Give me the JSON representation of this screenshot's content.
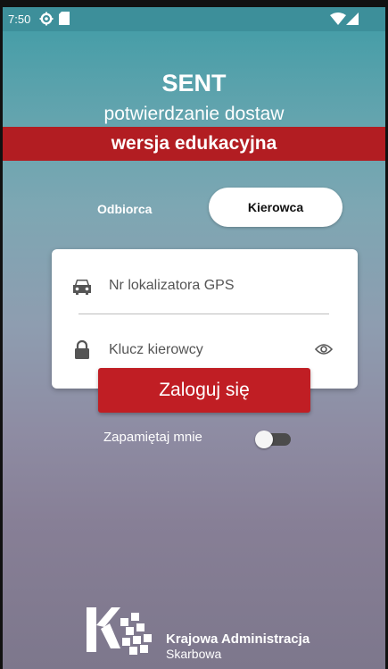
{
  "status_bar": {
    "time": "7:50",
    "icons": [
      "settings-icon",
      "sd-card-icon",
      "wifi-icon",
      "signal-icon"
    ]
  },
  "header": {
    "app_name": "SENT",
    "subtitle": "potwierdzanie dostaw",
    "edition_banner": "wersja edukacyjna"
  },
  "role_toggle": {
    "option_receiver": "Odbiorca",
    "option_driver": "Kierowca",
    "selected": "Kierowca"
  },
  "login_form": {
    "gps_field_placeholder": "Nr lokalizatora GPS",
    "driver_key_placeholder": "Klucz kierowcy",
    "login_button": "Zaloguj się",
    "remember_label": "Zapamiętaj mnie",
    "remember_enabled": false
  },
  "footer_logo": {
    "line1": "Krajowa Administracja",
    "line2": "Skarbowa"
  },
  "colors": {
    "accent_red": "#c01e24",
    "banner_red": "#b21d22",
    "status_bar": "#3d8f9a"
  }
}
